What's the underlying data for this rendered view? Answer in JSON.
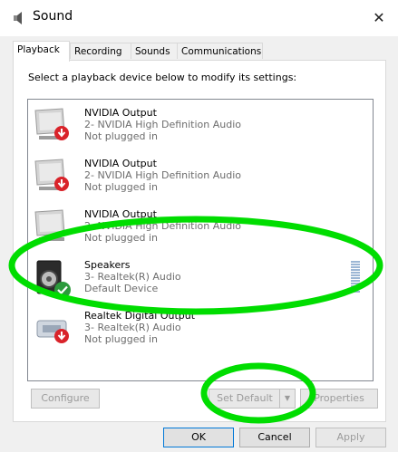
{
  "window": {
    "title": "Sound",
    "close_glyph": "✕"
  },
  "tabs": [
    {
      "label": "Playback",
      "active": true
    },
    {
      "label": "Recording",
      "active": false
    },
    {
      "label": "Sounds",
      "active": false
    },
    {
      "label": "Communications",
      "active": false
    }
  ],
  "instruction": "Select a playback device below to modify its settings:",
  "devices": [
    {
      "name": "NVIDIA Output",
      "driver": "2- NVIDIA High Definition Audio",
      "status": "Not plugged in",
      "icon": "monitor-icon",
      "badge": "unplugged-red-arrow-icon"
    },
    {
      "name": "NVIDIA Output",
      "driver": "2- NVIDIA High Definition Audio",
      "status": "Not plugged in",
      "icon": "monitor-icon",
      "badge": "unplugged-red-arrow-icon"
    },
    {
      "name": "NVIDIA Output",
      "driver": "2- NVIDIA High Definition Audio",
      "status": "Not plugged in",
      "icon": "monitor-icon",
      "badge": "unplugged-red-arrow-icon"
    },
    {
      "name": "Speakers",
      "driver": "3- Realtek(R) Audio",
      "status": "Default Device",
      "icon": "speaker-icon",
      "badge": "default-green-check-icon"
    },
    {
      "name": "Realtek Digital Output",
      "driver": "3- Realtek(R) Audio",
      "status": "Not plugged in",
      "icon": "digital-output-icon",
      "badge": "unplugged-red-arrow-icon"
    }
  ],
  "buttons": {
    "configure": "Configure",
    "set_default": "Set Default",
    "properties": "Properties",
    "ok": "OK",
    "cancel": "Cancel",
    "apply": "Apply"
  },
  "colors": {
    "annotation_green": "#00dd00",
    "unplugged_red": "#d9232a",
    "default_green": "#2c9a3c"
  }
}
